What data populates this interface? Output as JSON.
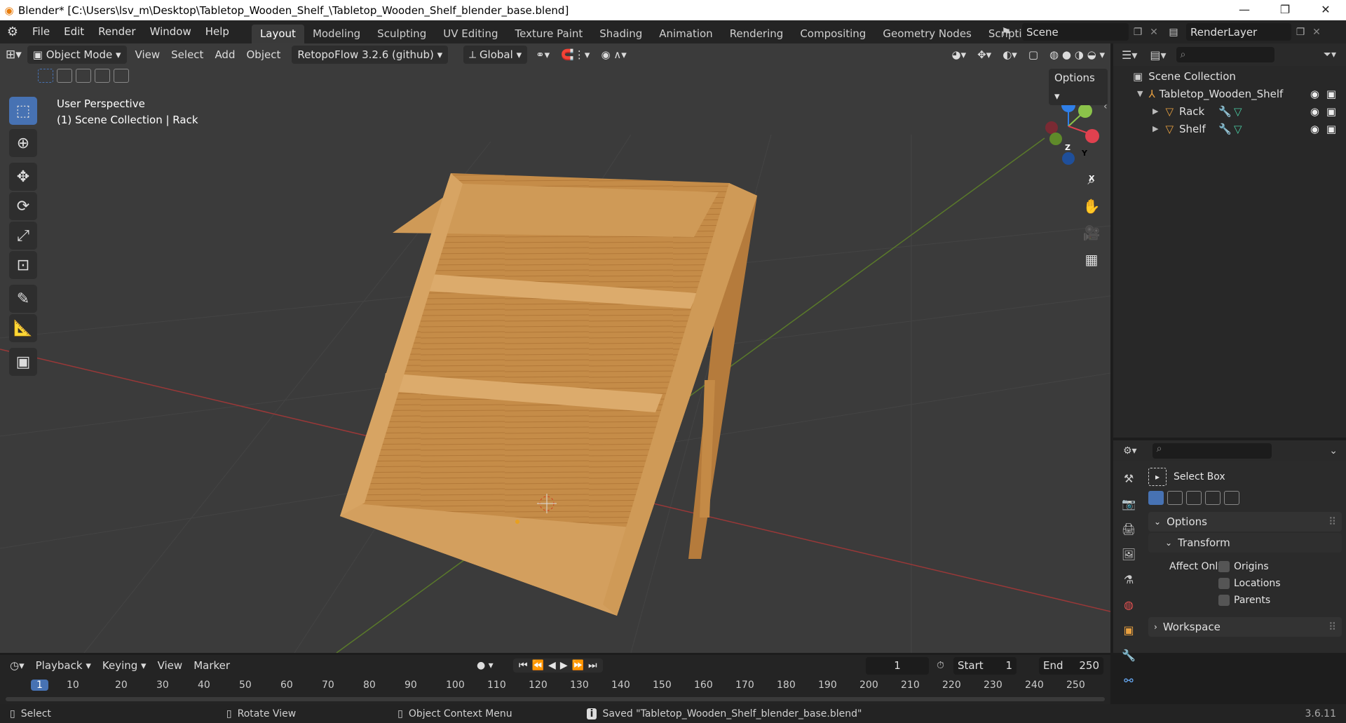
{
  "titlebar": {
    "title": "Blender* [C:\\Users\\lsv_m\\Desktop\\Tabletop_Wooden_Shelf_\\Tabletop_Wooden_Shelf_blender_base.blend]",
    "minimize": "—",
    "restore": "❐",
    "close": "✕"
  },
  "menu": {
    "items": [
      "File",
      "Edit",
      "Render",
      "Window",
      "Help"
    ]
  },
  "workspaces": {
    "tabs": [
      "Layout",
      "Modeling",
      "Sculpting",
      "UV Editing",
      "Texture Paint",
      "Shading",
      "Animation",
      "Rendering",
      "Compositing",
      "Geometry Nodes",
      "Scripting"
    ],
    "active": "Layout",
    "add": "+"
  },
  "scene": {
    "name": "Scene",
    "render_layer": "RenderLayer"
  },
  "viewport_header": {
    "mode": "Object Mode",
    "menus": [
      "View",
      "Select",
      "Add",
      "Object"
    ],
    "addon": "RetopoFlow 3.2.6 (github)",
    "orientation": "Global",
    "options": "Options"
  },
  "viewport": {
    "perspective": "User Perspective",
    "collection": "(1) Scene Collection | Rack",
    "gizmo": {
      "x": "X",
      "y": "Y",
      "z": "Z"
    }
  },
  "outliner": {
    "root": "Scene Collection",
    "collection": "Tabletop_Wooden_Shelf",
    "objects": [
      "Rack",
      "Shelf"
    ]
  },
  "properties": {
    "tool_name": "Select Box",
    "options_label": "Options",
    "transform_label": "Transform",
    "affect_only": "Affect Only",
    "checks": [
      "Origins",
      "Locations",
      "Parents"
    ],
    "workspace_label": "Workspace"
  },
  "timeline": {
    "menus": [
      "Playback",
      "Keying",
      "View",
      "Marker"
    ],
    "current_frame": "1",
    "start_label": "Start",
    "start": "1",
    "end_label": "End",
    "end": "250",
    "ticks": [
      "1",
      "10",
      "20",
      "30",
      "40",
      "50",
      "60",
      "70",
      "80",
      "90",
      "100",
      "110",
      "120",
      "130",
      "140",
      "150",
      "160",
      "170",
      "180",
      "190",
      "200",
      "210",
      "220",
      "230",
      "240",
      "250"
    ]
  },
  "status": {
    "select": "Select",
    "rotate": "Rotate View",
    "context": "Object Context Menu",
    "message": "Saved \"Tabletop_Wooden_Shelf_blender_base.blend\"",
    "version": "3.6.11"
  },
  "colors": {
    "accent": "#4772b3",
    "wood": "#c98f4a",
    "axis_x": "#e0414f",
    "axis_y": "#8bc34a",
    "axis_z": "#2f7fe8"
  }
}
